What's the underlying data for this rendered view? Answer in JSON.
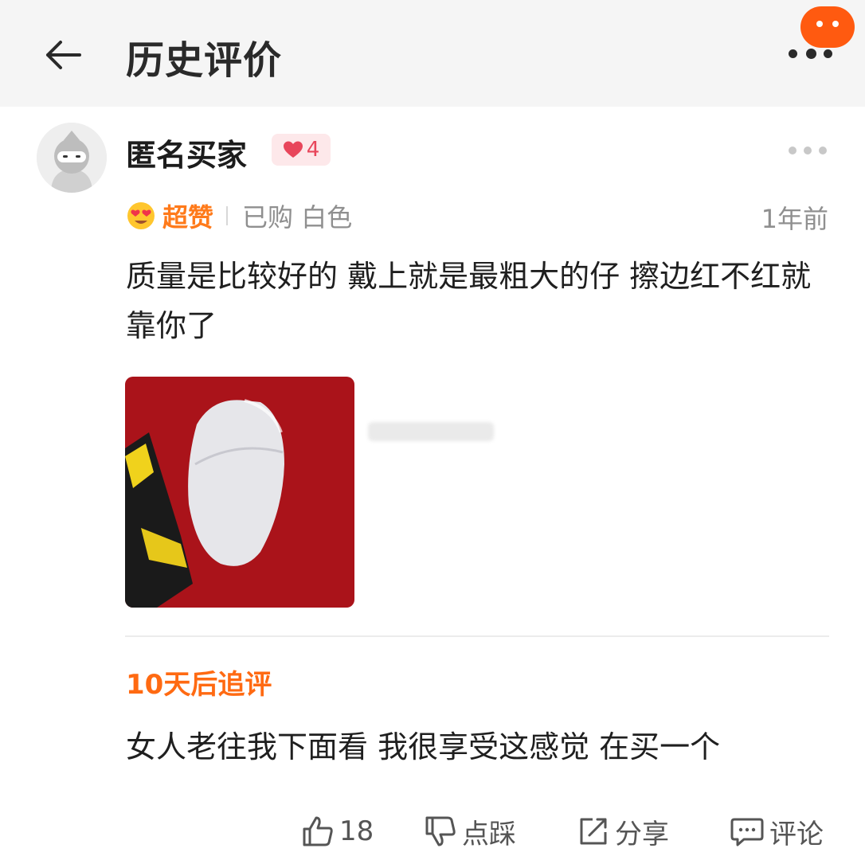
{
  "header": {
    "title": "历史评价",
    "back_icon": "arrow-left-icon",
    "more_icon": "more-dots-icon"
  },
  "review": {
    "username": "匿名买家",
    "like_badge": {
      "icon": "heart-icon",
      "count": "4",
      "color": "#e8465b"
    },
    "rating": {
      "icon": "heart-eyes-emoji-icon",
      "label": "超赞",
      "color": "#ff7a1a"
    },
    "purchase_info": "已购 白色",
    "time": "1年前",
    "text": "质量是比较好的 戴上就是最粗大的仔 擦边红不红就靠你了",
    "photo_icon": "product-photo-icon",
    "followup": {
      "label": "10天后追评",
      "text": "女人老往我下面看 我很享受这感觉 在买一个",
      "color": "#ff6a12"
    }
  },
  "actions": {
    "like": {
      "icon": "thumbs-up-icon",
      "label": "18"
    },
    "dislike": {
      "icon": "thumbs-down-icon",
      "label": "点踩"
    },
    "share": {
      "icon": "share-icon",
      "label": "分享"
    },
    "comment": {
      "icon": "comment-icon",
      "label": "评论"
    }
  },
  "colors": {
    "accent": "#ff5a10",
    "header_bg": "#f5f5f5"
  }
}
